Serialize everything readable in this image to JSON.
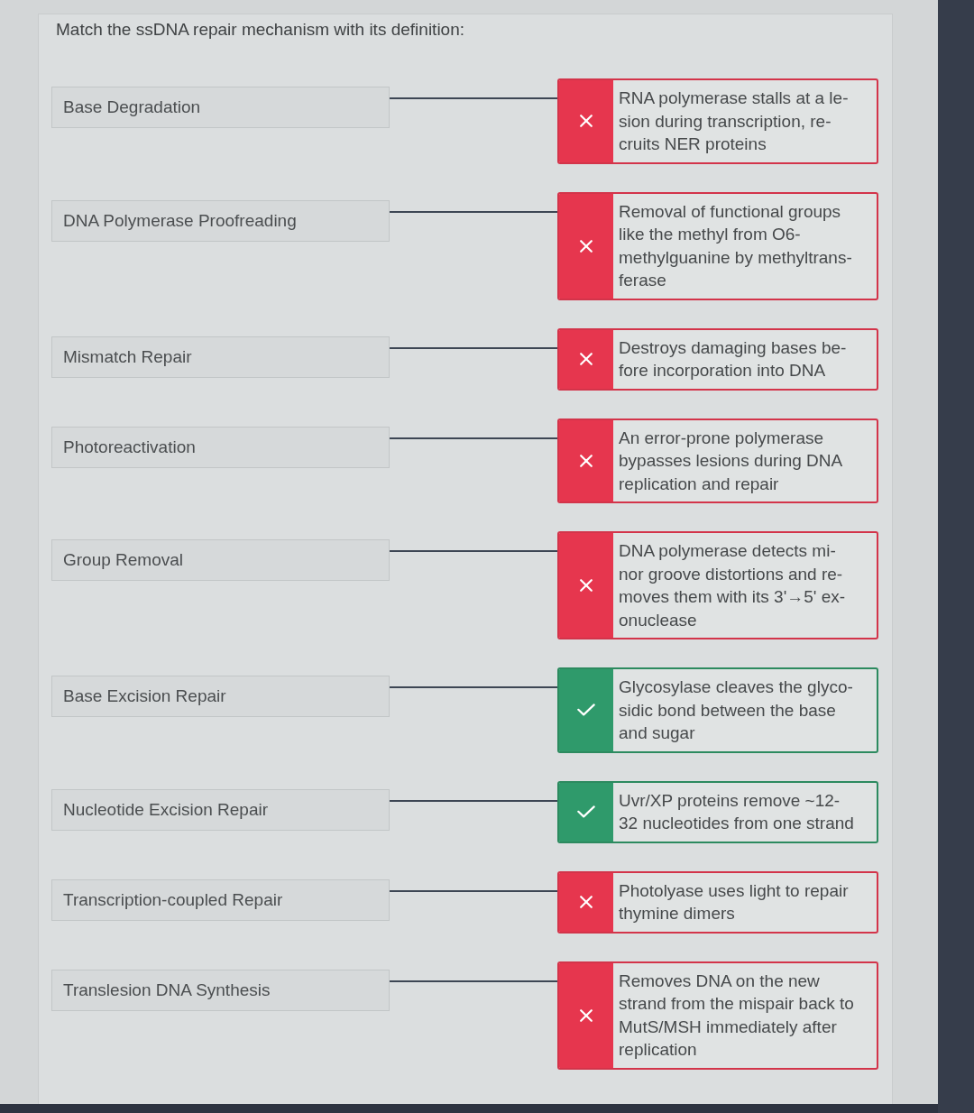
{
  "prompt": "Match the ssDNA repair mechanism with its definition:",
  "pairs": [
    {
      "term": "Base Degradation",
      "answer": "RNA polymerase stalls at a le-\nsion during transcription, re-\ncruits NER proteins",
      "correct": false
    },
    {
      "term": "DNA Polymerase Proofreading",
      "answer": "Removal of functional groups\nlike the methyl from O6-\nmethylguanine by methyltrans-\nferase",
      "correct": false
    },
    {
      "term": "Mismatch Repair",
      "answer": "Destroys damaging bases be-\nfore incorporation into DNA",
      "correct": false
    },
    {
      "term": "Photoreactivation",
      "answer": "An error-prone polymerase\nbypasses lesions during DNA\nreplication and repair",
      "correct": false
    },
    {
      "term": "Group Removal",
      "answer": "DNA polymerase detects mi-\nnor groove distortions and re-\nmoves them with its 3'→5' ex-\nonuclease",
      "correct": false
    },
    {
      "term": "Base Excision Repair",
      "answer": "Glycosylase cleaves the glyco-\nsidic bond between the base\nand sugar",
      "correct": true
    },
    {
      "term": "Nucleotide Excision Repair",
      "answer": "Uvr/XP proteins remove ~12-\n32 nucleotides from one strand",
      "correct": true
    },
    {
      "term": "Transcription-coupled Repair",
      "answer": "Photolyase uses light to repair\nthymine dimers",
      "correct": false
    },
    {
      "term": "Translesion DNA Synthesis",
      "answer": "Removes DNA on the new\nstrand from the mispair back to\nMutS/MSH immediately after\nreplication",
      "correct": false
    }
  ]
}
